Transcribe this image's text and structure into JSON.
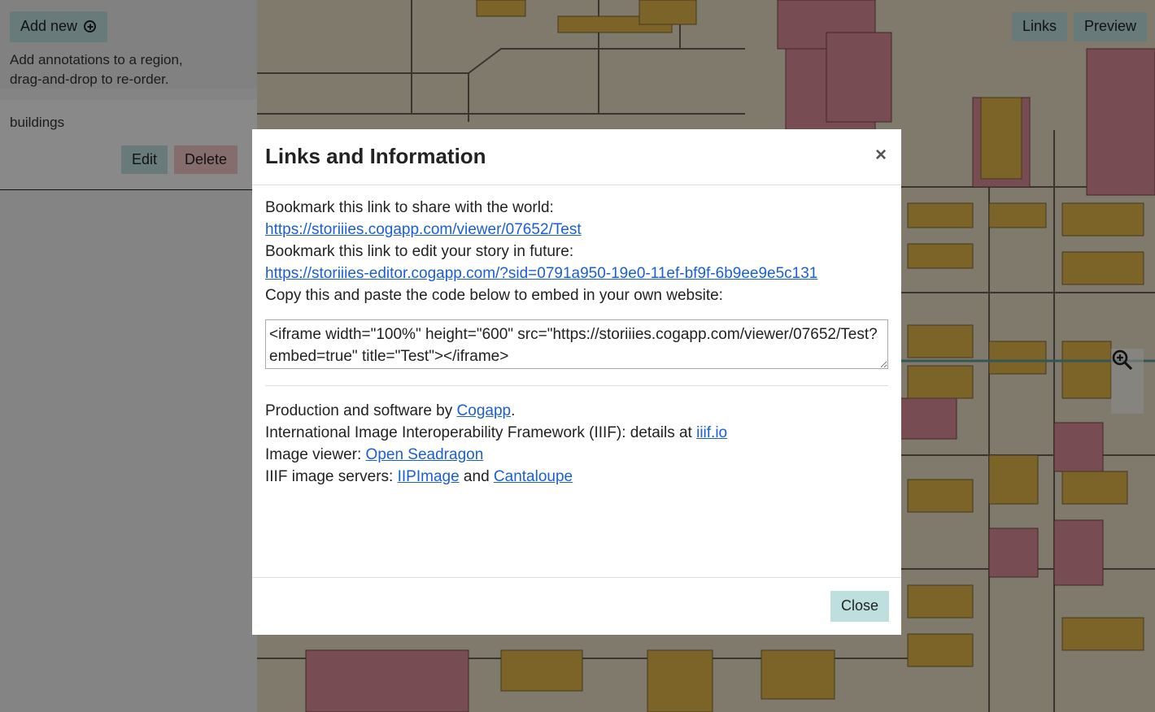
{
  "sidebar": {
    "add_new_label": "Add new",
    "hint": "Add annotations to a region, drag-and-drop to re-order.",
    "annotations": [
      {
        "title": "buildings",
        "edit_label": "Edit",
        "delete_label": "Delete"
      }
    ]
  },
  "toolbar": {
    "links_label": "Links",
    "preview_label": "Preview"
  },
  "zoom": {
    "in_icon": "zoom-in-icon",
    "out_icon": "zoom-out-icon"
  },
  "modal": {
    "title": "Links and Information",
    "close_x": "×",
    "share_intro": "Bookmark this link to share with the world:",
    "share_link": "https://storiiies.cogapp.com/viewer/07652/Test",
    "edit_intro": "Bookmark this link to edit your story in future:",
    "edit_link": "https://storiiies-editor.cogapp.com/?sid=0791a950-19e0-11ef-bf9f-6b9ee9e5c131",
    "embed_intro": "Copy this and paste the code below to embed in your own website:",
    "embed_code": "<iframe width=\"100%\" height=\"600\" src=\"https://storiiies.cogapp.com/viewer/07652/Test?embed=true\" title=\"Test\"></iframe>",
    "credits": {
      "production_prefix": "Production and software by ",
      "production_link": "Cogapp",
      "production_suffix": ".",
      "iiif_prefix": "International Image Interoperability Framework (IIIF): details at ",
      "iiif_link": "iiif.io",
      "viewer_prefix": "Image viewer: ",
      "viewer_link": "Open Seadragon",
      "servers_prefix": "IIIF image servers: ",
      "server_link_1": "IIPImage",
      "servers_and": " and ",
      "server_link_2": "Cantaloupe"
    },
    "close_label": "Close"
  },
  "colors": {
    "accent": "#bde0df",
    "danger": "#f4c6c6",
    "link": "#1a5fd6",
    "map_paper": "#e9dfc5",
    "map_red": "#d98a97",
    "map_yellow": "#e2b54a"
  }
}
